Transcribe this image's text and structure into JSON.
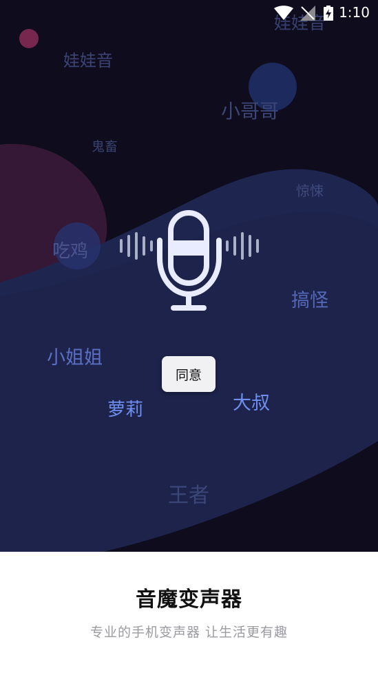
{
  "status_bar": {
    "time": "1:10",
    "icons": [
      "wifi-icon",
      "no-signal-icon",
      "battery-charging-icon"
    ]
  },
  "voice_tags": {
    "t1": "娃娃音",
    "t2": "娃娃音",
    "t3": "小哥哥",
    "t4": "鬼畜",
    "t5": "惊悚",
    "t6": "吃鸡",
    "t7": "搞怪",
    "t8": "小姐姐",
    "t9": "萝莉",
    "t10": "大叔",
    "t11": "王者"
  },
  "dialog": {
    "agree_label": "同意"
  },
  "footer": {
    "app_name": "音魔变声器",
    "slogan": "专业的手机变声器 让生活更有趣"
  },
  "colors": {
    "background": "#0f0c1d",
    "wave_blob": "#1e2650",
    "accent_blue": "#6f8ff0",
    "accent_pink": "#8a2d57",
    "mic": "#e9ebff"
  }
}
